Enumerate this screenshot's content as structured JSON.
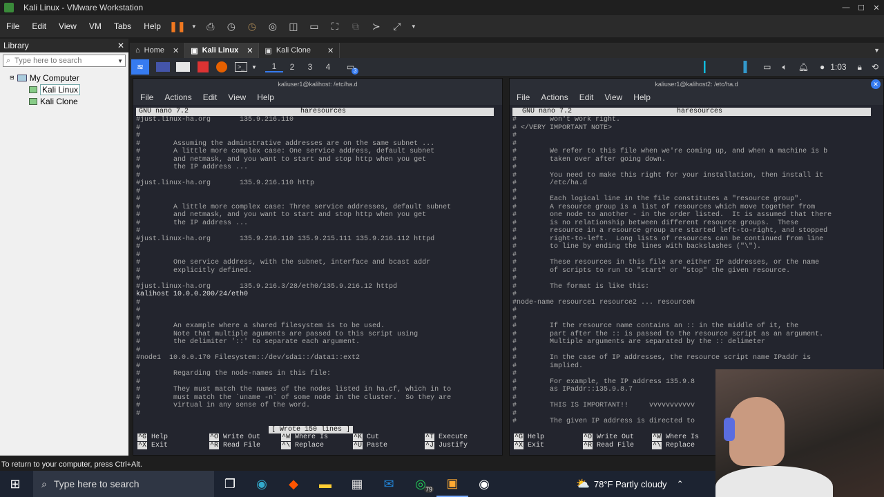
{
  "window": {
    "title": "Kali Linux - VMware Workstation"
  },
  "menu": [
    "File",
    "Edit",
    "View",
    "VM",
    "Tabs",
    "Help"
  ],
  "library": {
    "title": "Library",
    "search_placeholder": "Type here to search",
    "root": "My Computer",
    "vms": [
      "Kali Linux",
      "Kali Clone"
    ]
  },
  "vm_tabs": [
    {
      "label": "Home"
    },
    {
      "label": "Kali Linux"
    },
    {
      "label": "Kali Clone"
    }
  ],
  "kali_panel": {
    "workspaces": [
      "1",
      "2",
      "3",
      "4"
    ],
    "badge": "3",
    "time": "1:03"
  },
  "left_term": {
    "title": "kaliuser1@kalihost: /etc/ha.d",
    "menu": [
      "File",
      "Actions",
      "Edit",
      "View",
      "Help"
    ],
    "nano_version": "GNU nano 7.2",
    "filename": "haresources",
    "lines": [
      "#just.linux-ha.org       135.9.216.110",
      "#",
      "#",
      "#        Assuming the adminstrative addresses are on the same subnet ...",
      "#        A little more complex case: One service address, default subnet",
      "#        and netmask, and you want to start and stop http when you get",
      "#        the IP address ...",
      "#",
      "#just.linux-ha.org       135.9.216.110 http",
      "#",
      "#",
      "#        A little more complex case: Three service addresses, default subnet",
      "#        and netmask, and you want to start and stop http when you get",
      "#        the IP address ...",
      "#",
      "#just.linux-ha.org       135.9.216.110 135.9.215.111 135.9.216.112 httpd",
      "#",
      "#",
      "#        One service address, with the subnet, interface and bcast addr",
      "#        explicitly defined.",
      "#",
      "#just.linux-ha.org       135.9.216.3/28/eth0/135.9.216.12 httpd",
      "kalihost 10.0.0.200/24/eth0",
      "#",
      "#",
      "#",
      "#        An example where a shared filesystem is to be used.",
      "#        Note that multiple aguments are passed to this script using",
      "#        the delimiter '::' to separate each argument.",
      "#",
      "#node1  10.0.0.170 Filesystem::/dev/sda1::/data1::ext2",
      "#",
      "#        Regarding the node-names in this file:",
      "#",
      "#        They must match the names of the nodes listed in ha.cf, which in to",
      "#        must match the `uname -n` of some node in the cluster.  So they are",
      "#        virtual in any sense of the word.",
      "#"
    ],
    "status_msg": "[ Wrote 150 lines ]",
    "keys": [
      [
        "^G",
        "Help"
      ],
      [
        "^O",
        "Write Out"
      ],
      [
        "^W",
        "Where Is"
      ],
      [
        "^K",
        "Cut"
      ],
      [
        "^T",
        "Execute"
      ],
      [
        "^X",
        "Exit"
      ],
      [
        "^R",
        "Read File"
      ],
      [
        "^\\",
        "Replace"
      ],
      [
        "^U",
        "Paste"
      ],
      [
        "^J",
        "Justify"
      ]
    ]
  },
  "right_term": {
    "title": "kaliuser1@kalihost2: /etc/ha.d",
    "menu": [
      "File",
      "Actions",
      "Edit",
      "View",
      "Help"
    ],
    "nano_version": "GNU nano 7.2",
    "filename": "haresources",
    "lines": [
      "#        won't work right.",
      "# </VERY IMPORTANT NOTE>",
      "#",
      "#",
      "#        We refer to this file when we're coming up, and when a machine is b",
      "#        taken over after going down.",
      "#",
      "#        You need to make this right for your installation, then install it",
      "#        /etc/ha.d",
      "#",
      "#        Each logical line in the file constitutes a \"resource group\".",
      "#        A resource group is a list of resources which move together from",
      "#        one node to another - in the order listed.  It is assumed that there",
      "#        is no relationship between different resource groups.  These",
      "#        resource in a resource group are started left-to-right, and stopped",
      "#        right-to-left.  Long lists of resources can be continued from line",
      "#        to line by ending the lines with backslashes (\"\\\").",
      "#",
      "#        These resources in this file are either IP addresses, or the name",
      "#        of scripts to run to \"start\" or \"stop\" the given resource.",
      "#",
      "#        The format is like this:",
      "#",
      "#node-name resource1 resource2 ... resourceN",
      "#",
      "#",
      "#        If the resource name contains an :: in the middle of it, the",
      "#        part after the :: is passed to the resource script as an argument.",
      "#        Multiple arguments are separated by the :: delimeter",
      "#",
      "#        In the case of IP addresses, the resource script name IPaddr is",
      "#        implied.",
      "#",
      "#        For example, the IP address 135.9.8",
      "#        as IPaddr::135.9.8.7",
      "#",
      "#        THIS IS IMPORTANT!!     vvvvvvvvvvv",
      "#",
      "#        The given IP address is directed to"
    ],
    "keys": [
      [
        "^G",
        "Help"
      ],
      [
        "^O",
        "Write Out"
      ],
      [
        "^W",
        "Where Is"
      ],
      [
        "^X",
        "Exit"
      ],
      [
        "^R",
        "Read File"
      ],
      [
        "^\\",
        "Replace"
      ]
    ]
  },
  "status_bar": "To return to your computer, press Ctrl+Alt.",
  "taskbar": {
    "search_placeholder": "Type here to search",
    "whatsapp_badge": "79",
    "weather": "78°F  Partly cloudy"
  },
  "colors": {
    "accent": "#367bf0",
    "terminal_bg": "#23252e",
    "nano_bar": "#dedede"
  }
}
